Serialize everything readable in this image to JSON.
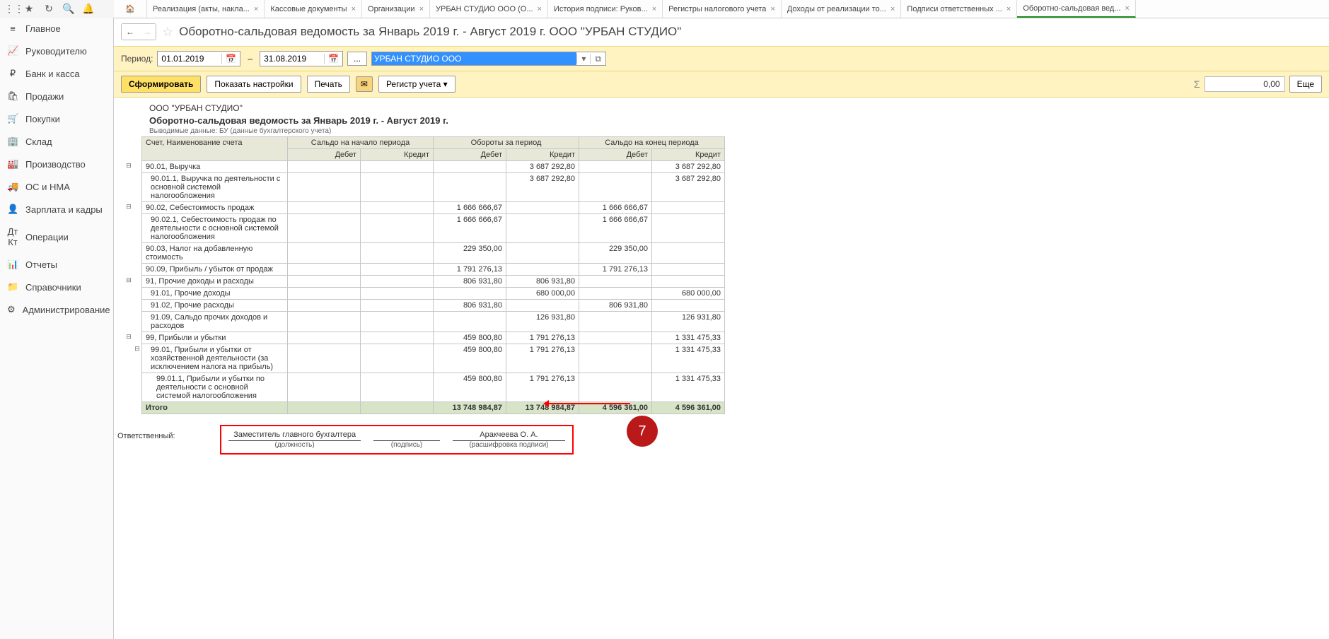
{
  "top_icons": [
    "apps",
    "star",
    "clock",
    "search",
    "bell"
  ],
  "tabs": [
    {
      "label": "",
      "home": true
    },
    {
      "label": "Реализация (акты, накла..."
    },
    {
      "label": "Кассовые документы"
    },
    {
      "label": "Организации"
    },
    {
      "label": "УРБАН СТУДИО ООО (О..."
    },
    {
      "label": "История подписи: Руков..."
    },
    {
      "label": "Регистры налогового учета"
    },
    {
      "label": "Доходы от реализации то..."
    },
    {
      "label": "Подписи ответственных ..."
    },
    {
      "label": "Оборотно-сальдовая вед...",
      "active": true
    }
  ],
  "sidebar": [
    {
      "icon": "≡",
      "label": "Главное"
    },
    {
      "icon": "📈",
      "label": "Руководителю"
    },
    {
      "icon": "₽",
      "label": "Банк и касса"
    },
    {
      "icon": "🛍",
      "label": "Продажи"
    },
    {
      "icon": "🛒",
      "label": "Покупки"
    },
    {
      "icon": "🏢",
      "label": "Склад"
    },
    {
      "icon": "🏭",
      "label": "Производство"
    },
    {
      "icon": "🚚",
      "label": "ОС и НМА"
    },
    {
      "icon": "👤",
      "label": "Зарплата и кадры"
    },
    {
      "icon": "Дт Кт",
      "label": "Операции"
    },
    {
      "icon": "📊",
      "label": "Отчеты"
    },
    {
      "icon": "📁",
      "label": "Справочники"
    },
    {
      "icon": "⚙",
      "label": "Администрирование"
    }
  ],
  "page_title": "Оборотно-сальдовая ведомость за Январь 2019 г. - Август 2019 г. ООО \"УРБАН СТУДИО\"",
  "period_label": "Период:",
  "date_from": "01.01.2019",
  "date_to": "31.08.2019",
  "org_value": "УРБАН СТУДИО ООО",
  "buttons": {
    "form": "Сформировать",
    "settings": "Показать настройки",
    "print": "Печать",
    "register": "Регистр учета ▾",
    "more": "Еще"
  },
  "sum_value": "0,00",
  "report": {
    "org": "ООО \"УРБАН СТУДИО\"",
    "title": "Оборотно-сальдовая ведомость за Январь 2019 г. - Август 2019 г.",
    "output": "Выводимые данные: БУ (данные бухгалтерского учета)",
    "head": {
      "acc": "Счет, Наименование счета",
      "g1": "Сальдо на начало периода",
      "g2": "Обороты за период",
      "g3": "Сальдо на конец периода",
      "d": "Дебет",
      "k": "Кредит"
    },
    "rows": [
      {
        "exp": "⊟",
        "cls": "",
        "acc": "90.01, Выручка",
        "c": [
          "",
          "",
          "",
          "3 687 292,80",
          "",
          "3 687 292,80"
        ]
      },
      {
        "exp": "",
        "cls": "sub1",
        "acc": "90.01.1, Выручка по деятельности с основной системой налогообложения",
        "c": [
          "",
          "",
          "",
          "3 687 292,80",
          "",
          "3 687 292,80"
        ]
      },
      {
        "exp": "⊟",
        "cls": "",
        "acc": "90.02, Себестоимость продаж",
        "c": [
          "",
          "",
          "1 666 666,67",
          "",
          "1 666 666,67",
          ""
        ]
      },
      {
        "exp": "",
        "cls": "sub1",
        "acc": "90.02.1, Себестоимость продаж по деятельности с основной системой налогообложения",
        "c": [
          "",
          "",
          "1 666 666,67",
          "",
          "1 666 666,67",
          ""
        ]
      },
      {
        "exp": "",
        "cls": "",
        "acc": "90.03, Налог на добавленную стоимость",
        "c": [
          "",
          "",
          "229 350,00",
          "",
          "229 350,00",
          ""
        ]
      },
      {
        "exp": "",
        "cls": "",
        "acc": "90.09, Прибыль / убыток от продаж",
        "c": [
          "",
          "",
          "1 791 276,13",
          "",
          "1 791 276,13",
          ""
        ]
      },
      {
        "exp": "⊟",
        "cls": "",
        "acc": "91, Прочие доходы и расходы",
        "c": [
          "",
          "",
          "806 931,80",
          "806 931,80",
          "",
          ""
        ]
      },
      {
        "exp": "",
        "cls": "sub1",
        "acc": "91.01, Прочие доходы",
        "c": [
          "",
          "",
          "",
          "680 000,00",
          "",
          "680 000,00"
        ]
      },
      {
        "exp": "",
        "cls": "sub1",
        "acc": "91.02, Прочие расходы",
        "c": [
          "",
          "",
          "806 931,80",
          "",
          "806 931,80",
          ""
        ]
      },
      {
        "exp": "",
        "cls": "sub1",
        "acc": "91.09, Сальдо прочих доходов и расходов",
        "c": [
          "",
          "",
          "",
          "126 931,80",
          "",
          "126 931,80"
        ]
      },
      {
        "exp": "⊟",
        "cls": "",
        "acc": "99, Прибыли и убытки",
        "c": [
          "",
          "",
          "459 800,80",
          "1 791 276,13",
          "",
          "1 331 475,33"
        ]
      },
      {
        "exp": "⊟",
        "cls": "sub1",
        "acc": "99.01, Прибыли и убытки от хозяйственной деятельности (за исключением налога на прибыль)",
        "c": [
          "",
          "",
          "459 800,80",
          "1 791 276,13",
          "",
          "1 331 475,33"
        ]
      },
      {
        "exp": "",
        "cls": "sub2",
        "acc": "99.01.1, Прибыли и убытки по деятельности с основной системой налогообложения",
        "c": [
          "",
          "",
          "459 800,80",
          "1 791 276,13",
          "",
          "1 331 475,33"
        ]
      }
    ],
    "total": {
      "label": "Итого",
      "c": [
        "",
        "",
        "13 748 984,87",
        "13 748 984,87",
        "4 596 361,00",
        "4 596 361,00"
      ]
    }
  },
  "sign": {
    "resp": "Ответственный:",
    "position": "Заместитель главного бухгалтера",
    "position_sub": "(должность)",
    "sig_sub": "(подпись)",
    "name": "Аракчеева О. А.",
    "name_sub": "(расшифровка подписи)"
  },
  "callout": "7"
}
